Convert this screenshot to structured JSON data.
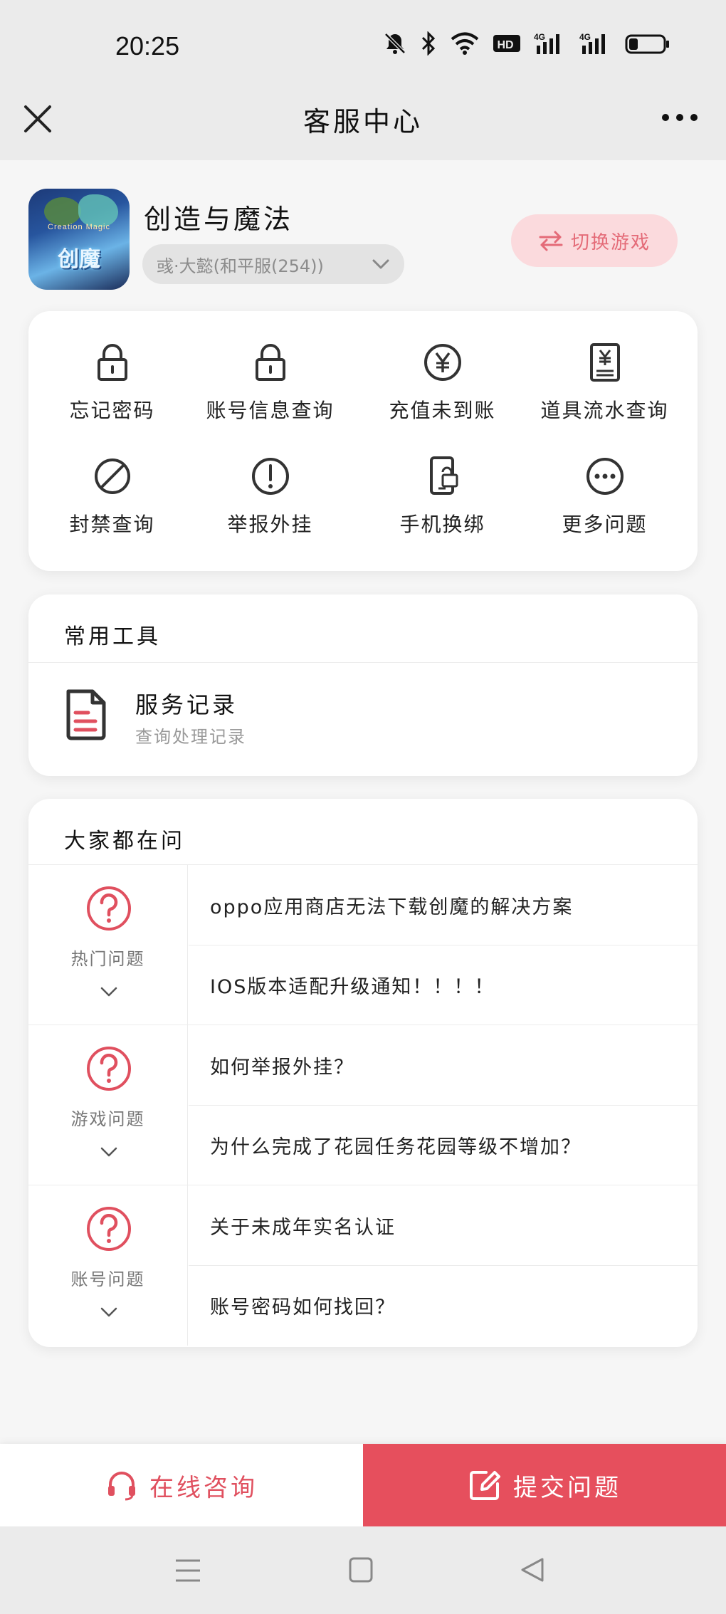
{
  "status_bar": {
    "time": "20:25",
    "icons": [
      "mute-icon",
      "bluetooth-icon",
      "wifi-icon",
      "hd-icon",
      "signal-4g-icon",
      "signal-4g-icon",
      "battery-icon"
    ],
    "hd_label": "HD",
    "network_label": "4G"
  },
  "header": {
    "title": "客服中心",
    "close_icon": "close-icon",
    "more_icon": "more-icon"
  },
  "game": {
    "name": "创造与魔法",
    "icon_text": "创魔",
    "icon_subtext": "Creation Magic",
    "server": "彧·大懿(和平服(254))",
    "switch_label": "切换游戏"
  },
  "quick_actions": [
    {
      "label": "忘记密码",
      "icon": "lock-icon"
    },
    {
      "label": "账号信息查询",
      "icon": "lock-icon"
    },
    {
      "label": "充值未到账",
      "icon": "yen-coin-icon"
    },
    {
      "label": "道具流水查询",
      "icon": "receipt-icon"
    },
    {
      "label": "封禁查询",
      "icon": "ban-icon"
    },
    {
      "label": "举报外挂",
      "icon": "alert-icon"
    },
    {
      "label": "手机换绑",
      "icon": "phone-switch-icon"
    },
    {
      "label": "更多问题",
      "icon": "more-circle-icon"
    }
  ],
  "tools": {
    "title": "常用工具",
    "items": [
      {
        "title": "服务记录",
        "subtitle": "查询处理记录",
        "icon": "document-icon"
      }
    ]
  },
  "faq": {
    "title": "大家都在问",
    "groups": [
      {
        "label": "热门问题",
        "questions": [
          "oppo应用商店无法下载创魔的解决方案",
          "IOS版本适配升级通知！！！！"
        ]
      },
      {
        "label": "游戏问题",
        "questions": [
          "如何举报外挂？",
          "为什么完成了花园任务花园等级不增加？"
        ]
      },
      {
        "label": "账号问题",
        "questions": [
          "关于未成年实名认证",
          "账号密码如何找回？"
        ]
      }
    ]
  },
  "bottom_bar": {
    "consult_label": "在线咨询",
    "submit_label": "提交问题"
  },
  "colors": {
    "accent": "#e64f5d",
    "accent_light": "#fbdadd",
    "background": "#f6f6f6",
    "system_bar": "#ebebeb"
  }
}
